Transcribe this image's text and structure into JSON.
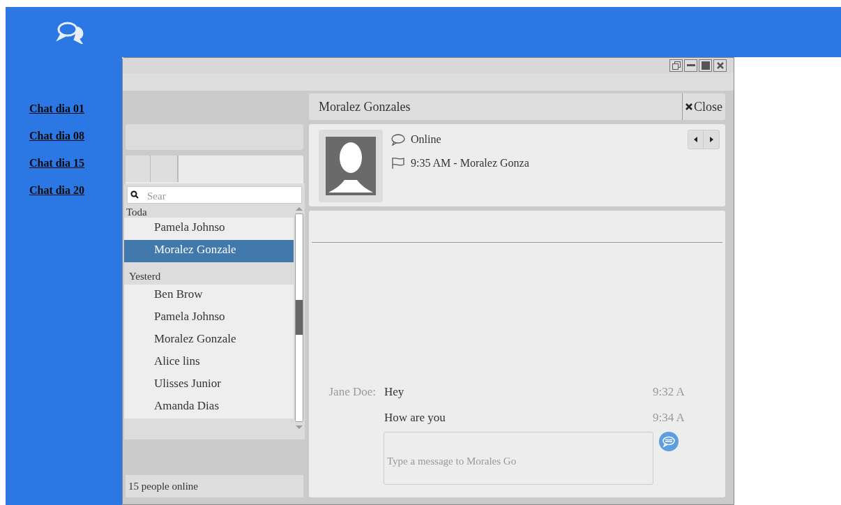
{
  "nav_links": [
    "Chat dia 01",
    "Chat dia 08",
    "Chat dia 15",
    "Chat dia 20"
  ],
  "sidebar": {
    "search": {
      "placeholder": "Sear"
    },
    "groups": [
      {
        "label": "Toda",
        "contacts": [
          {
            "name": "Pamela Johnso",
            "selected": false
          },
          {
            "name": "Moralez Gonzale",
            "selected": true
          }
        ]
      },
      {
        "label": "Yesterd",
        "contacts": [
          {
            "name": "Ben Brow",
            "selected": false
          },
          {
            "name": "Pamela Johnso",
            "selected": false
          },
          {
            "name": "Moralez Gonzale",
            "selected": false
          },
          {
            "name": "Alice lins",
            "selected": false
          },
          {
            "name": "Ulisses Junior",
            "selected": false
          },
          {
            "name": "Amanda Dias",
            "selected": false
          }
        ]
      }
    ],
    "status": "15 people online"
  },
  "chat": {
    "title": "Moralez Gonzales",
    "close": "Close",
    "status": "Online",
    "last_activity": "9:35 AM - Moralez Gonza",
    "messages": [
      {
        "sender": "Jane Doe:",
        "text": "Hey",
        "time": "9:32 A"
      },
      {
        "text": "How are you",
        "time": "9:34 A"
      }
    ],
    "input": {
      "placeholder": "Type a message to Morales Go"
    }
  }
}
